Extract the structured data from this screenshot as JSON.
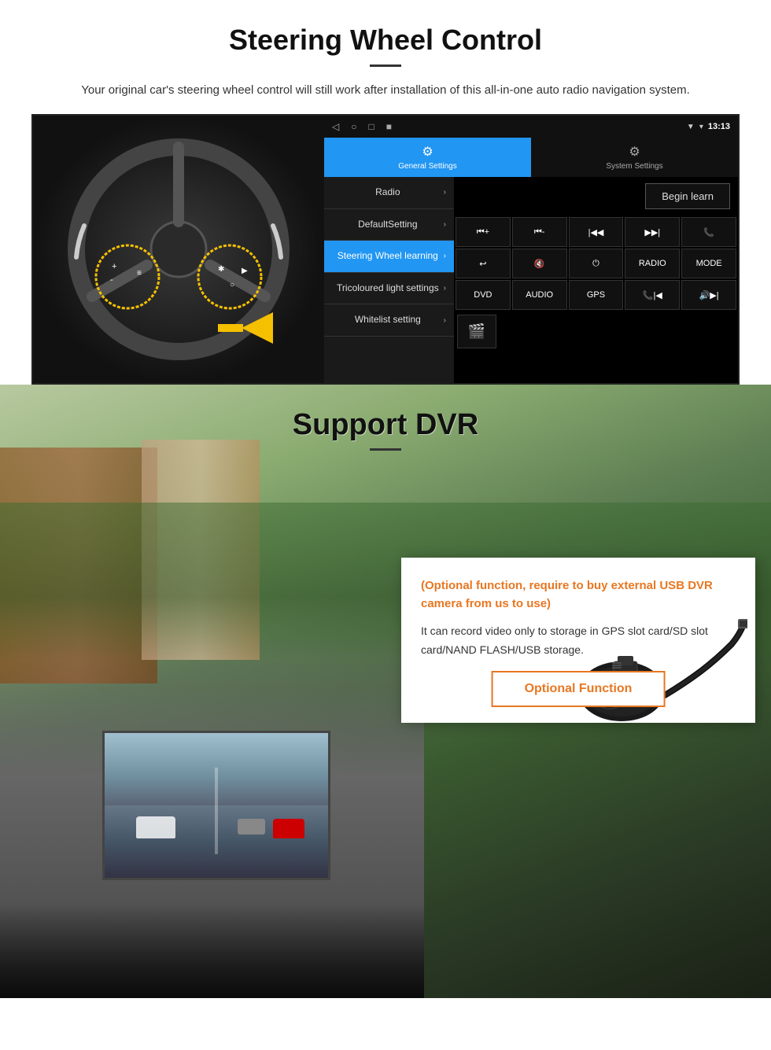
{
  "steering": {
    "title": "Steering Wheel Control",
    "subtitle": "Your original car's steering wheel control will still work after installation of this all-in-one auto radio navigation system.",
    "android": {
      "status_time": "13:13",
      "nav_back": "◁",
      "nav_home": "○",
      "nav_square": "□",
      "nav_dot": "■",
      "tab_general": "General Settings",
      "tab_system": "System Settings",
      "tab_general_icon": "⚙",
      "tab_system_icon": "🔧",
      "begin_learn": "Begin learn",
      "menu_items": [
        {
          "label": "Radio",
          "active": false
        },
        {
          "label": "DefaultSetting",
          "active": false
        },
        {
          "label": "Steering Wheel learning",
          "active": true
        },
        {
          "label": "Tricoloured light settings",
          "active": false
        },
        {
          "label": "Whitelist setting",
          "active": false
        }
      ],
      "controls": [
        "⏮+",
        "⏮-",
        "⏮|",
        "|⏭",
        "📞",
        "↩",
        "🔇",
        "⏻",
        "RADIO",
        "MODE",
        "DVD",
        "AUDIO",
        "GPS",
        "📞⏮|",
        "🔊⏭"
      ],
      "dvr_icon": "🎬"
    }
  },
  "dvr": {
    "title": "Support DVR",
    "optional_notice": "(Optional function, require to buy external USB DVR camera from us to use)",
    "description": "It can record video only to storage in GPS slot card/SD slot card/NAND FLASH/USB storage.",
    "optional_button": "Optional Function"
  }
}
